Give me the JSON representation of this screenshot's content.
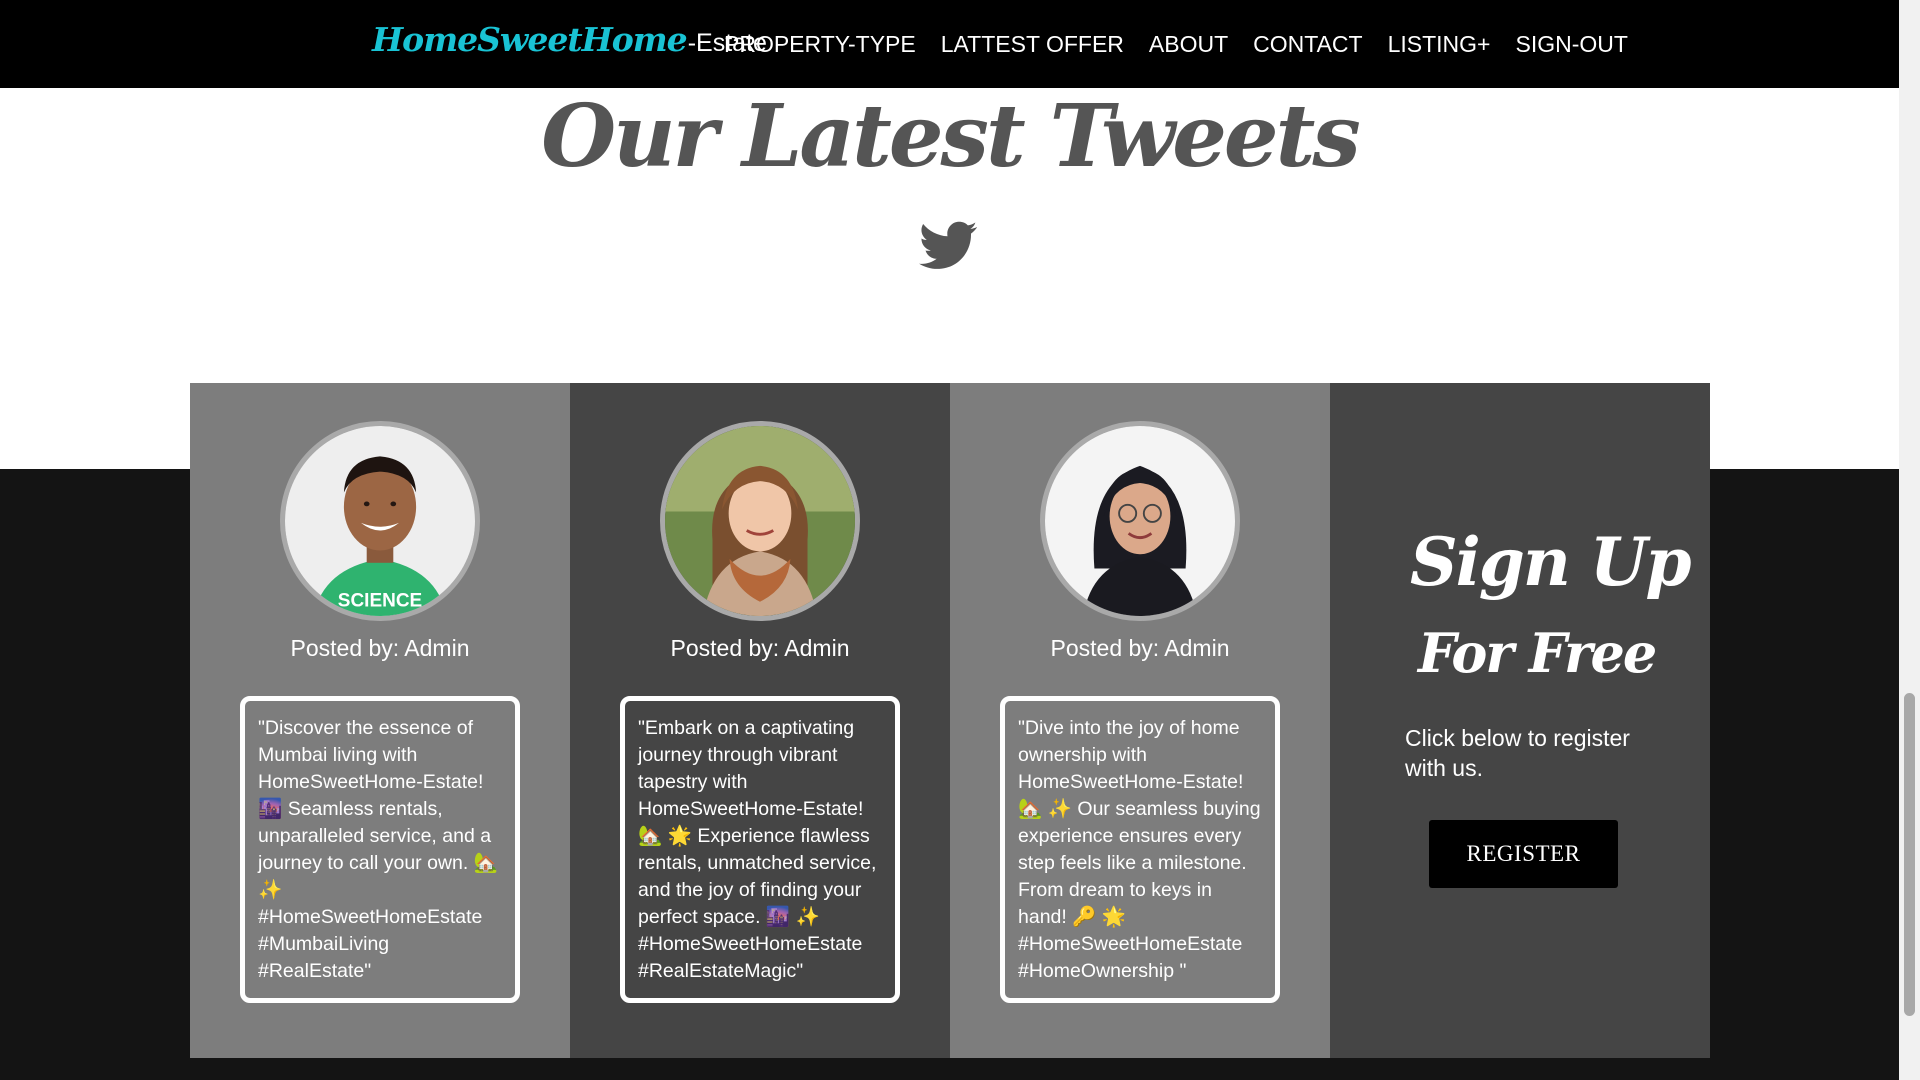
{
  "brand": {
    "main": "HomeSweetHome",
    "suffix": "-Estate"
  },
  "nav": {
    "items": [
      "PROPERTY-TYPE",
      "LATTEST OFFER",
      "ABOUT",
      "CONTACT",
      "LISTING+",
      "SIGN-OUT"
    ]
  },
  "tweets_section": {
    "title": "Our Latest Tweets",
    "icon": "twitter-icon",
    "cards": [
      {
        "posted_by": "Posted by: Admin",
        "text": "\"Discover the essence of Mumbai living with HomeSweetHome-Estate! 🌆 Seamless rentals, unparalleled service, and a journey to call your own. 🏡 ✨ #HomeSweetHomeEstate #MumbaiLiving #RealEstate\""
      },
      {
        "posted_by": "Posted by: Admin",
        "text": "\"Embark on a captivating journey through vibrant tapestry with HomeSweetHome-Estate! 🏡 🌟 Experience flawless rentals, unmatched service, and the joy of finding your perfect space. 🌆 ✨ #HomeSweetHomeEstate #RealEstateMagic\""
      },
      {
        "posted_by": "Posted by: Admin",
        "text": "\"Dive into the joy of home ownership with HomeSweetHome-Estate! 🏡 ✨ Our seamless buying experience ensures every step feels like a milestone. From dream to keys in hand! 🔑 🌟 #HomeSweetHomeEstate #HomeOwnership \""
      }
    ]
  },
  "signup": {
    "title_line1": "Sign Up",
    "title_line2": "For Free",
    "text": "Click below to register with us.",
    "button": "REGISTER"
  },
  "colors": {
    "brand_accent": "#19c3d4",
    "navbar_bg": "#000000",
    "card_light": "#7d7d7d",
    "card_dark": "#454545",
    "band_bg": "#141414",
    "heading": "#555555"
  }
}
